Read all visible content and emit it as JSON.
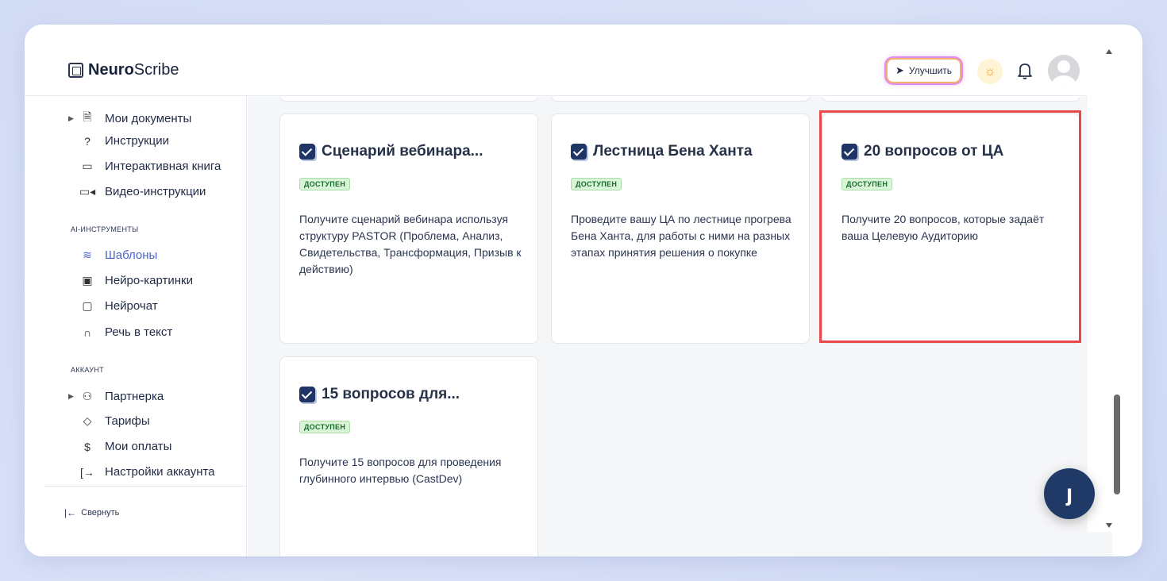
{
  "header": {
    "logo_bold": "Neuro",
    "logo_light": "Scribe",
    "upgrade_label": "Улучшить"
  },
  "sidebar": {
    "items_top": [
      {
        "label": "Мои документы",
        "icon": "document-icon",
        "expandable": true
      },
      {
        "label": "Инструкции",
        "icon": "help-circle-icon"
      },
      {
        "label": "Интерактивная книга",
        "icon": "book-icon"
      },
      {
        "label": "Видео-инструкции",
        "icon": "video-icon"
      }
    ],
    "section_ai": "AI-ИНСТРУМЕНТЫ",
    "items_ai": [
      {
        "label": "Шаблоны",
        "icon": "layers-icon",
        "active": true
      },
      {
        "label": "Нейро-картинки",
        "icon": "image-icon"
      },
      {
        "label": "Нейрочат",
        "icon": "chat-icon"
      },
      {
        "label": "Речь в текст",
        "icon": "headphones-icon"
      }
    ],
    "section_account": "АККАУНТ",
    "items_account": [
      {
        "label": "Партнерка",
        "icon": "users-icon",
        "expandable": true
      },
      {
        "label": "Тарифы",
        "icon": "tag-icon"
      },
      {
        "label": "Мои оплаты",
        "icon": "dollar-icon"
      },
      {
        "label": "Настройки аккаунта",
        "icon": "logout-icon"
      }
    ],
    "collapse_label": "Свернуть"
  },
  "cards": [
    {
      "title": "Сценарий вебинара...",
      "badge": "ДОСТУПЕН",
      "desc": "Получите сценарий вебинара используя структуру PASTOR (Проблема, Анализ, Свидетельства, Трансформация, Призыв к действию)"
    },
    {
      "title": "Лестница Бена Ханта",
      "badge": "ДОСТУПЕН",
      "desc": "Проведите вашу ЦА по лестнице прогрева Бена Ханта, для работы с ними на разных этапах принятия решения о покупке"
    },
    {
      "title": "20 вопросов от ЦА",
      "badge": "ДОСТУПЕН",
      "desc": "Получите 20 вопросов, которые задаёт ваша Целевую Аудиторию"
    },
    {
      "title": "15 вопросов для...",
      "badge": "ДОСТУПЕН",
      "desc": "Получите 15 вопросов для проведения глубинного интервью (CastDev)"
    }
  ],
  "chat_fab_glyph": "ȷ",
  "colors": {
    "accent": "#4a63c9",
    "badge_bg": "#d8f5d8",
    "highlight": "#e84a4a",
    "fab": "#1f3a66"
  }
}
